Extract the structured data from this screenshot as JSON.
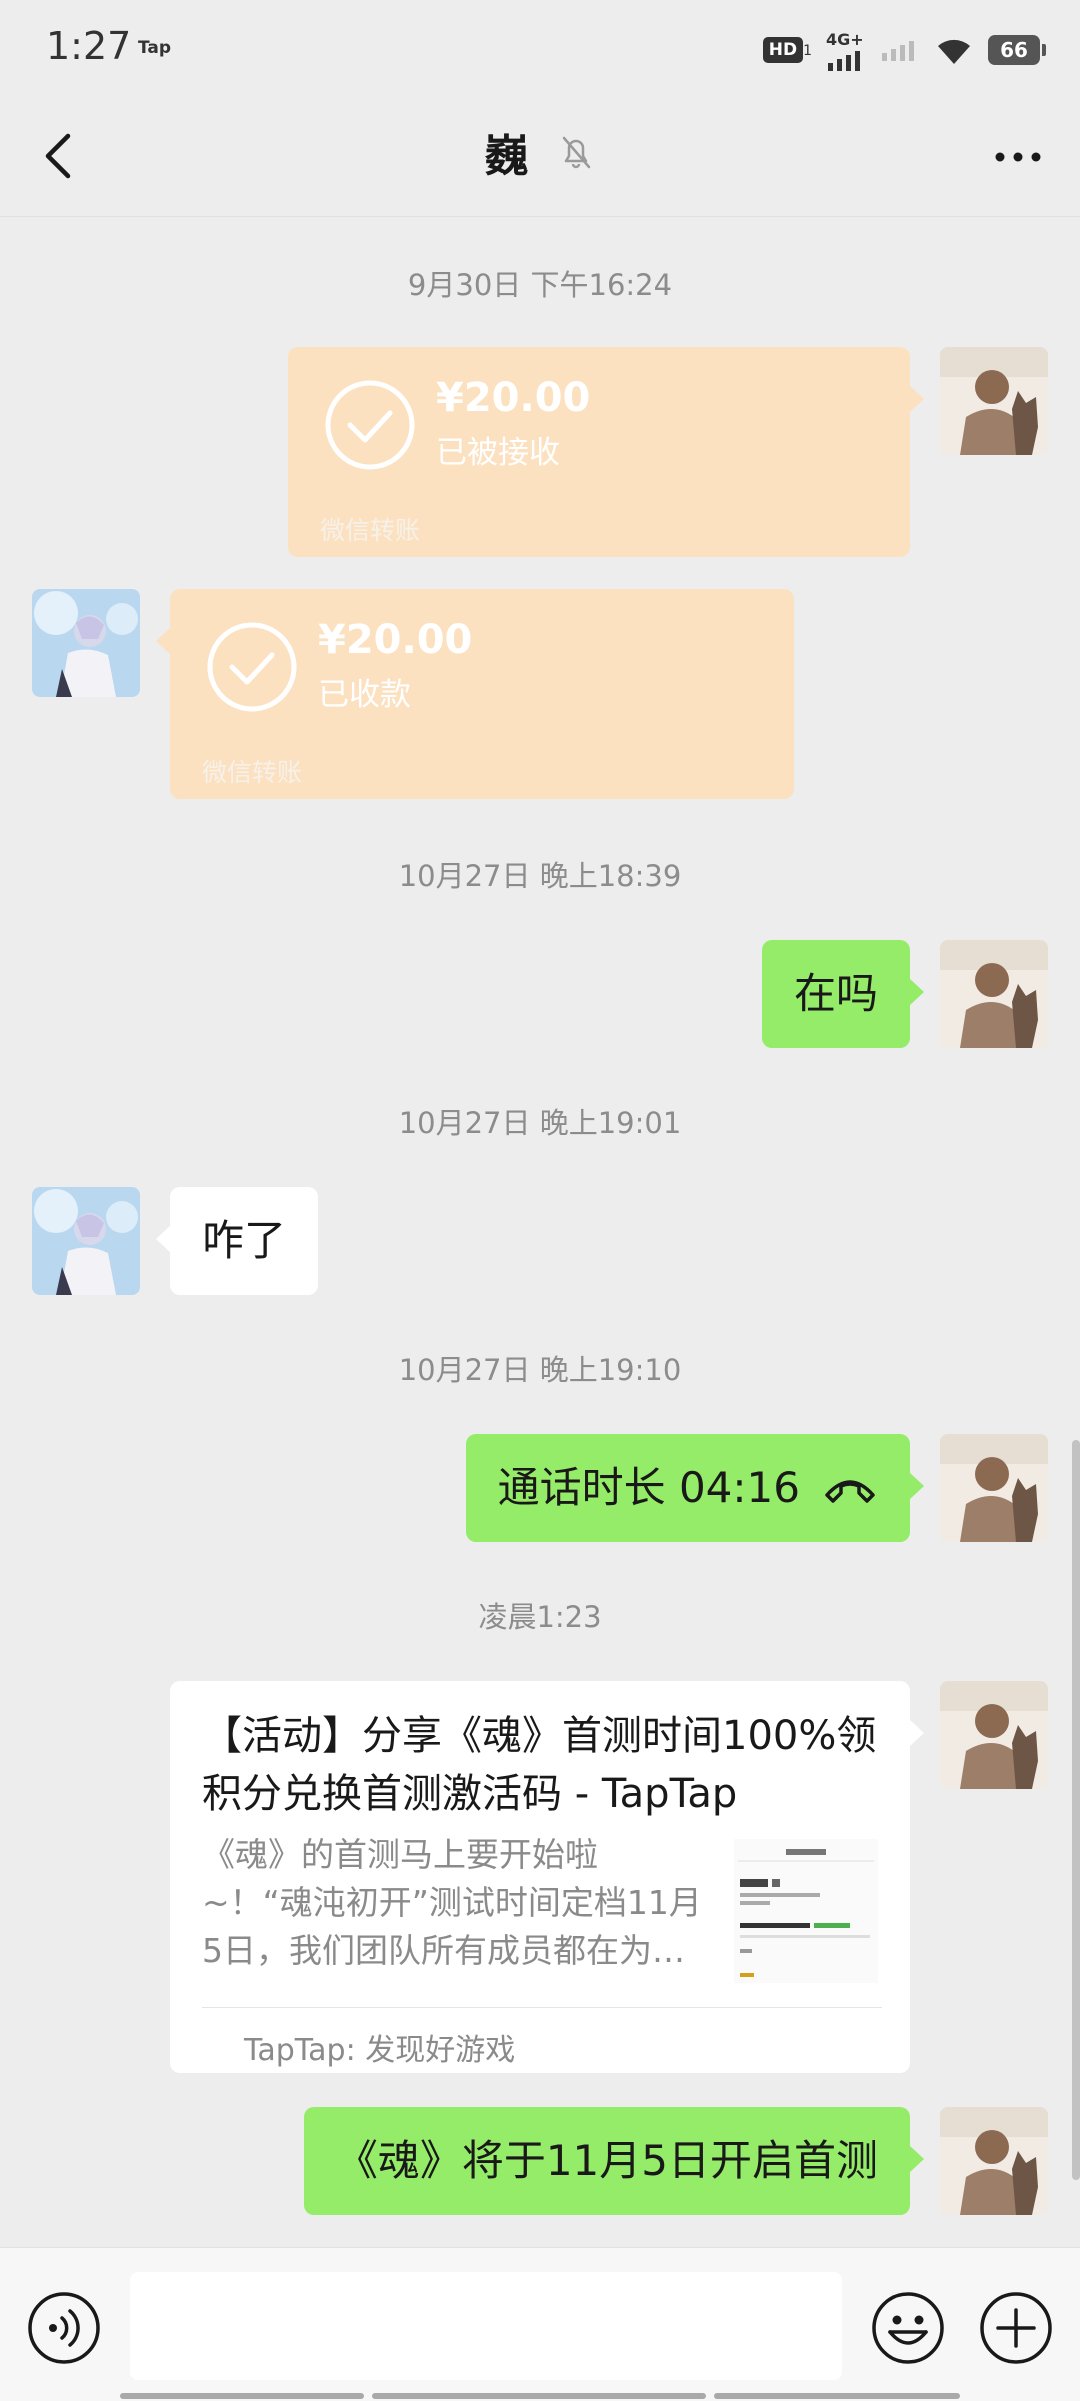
{
  "status_bar": {
    "time": "1:27",
    "app_label": "Tap",
    "hd_badge": "HD",
    "hd_sub": "1",
    "network": "4G+",
    "battery": "66"
  },
  "header": {
    "title": "巍"
  },
  "messages": {
    "ts1": "9月30日 下午16:24",
    "transfer_sent": {
      "amount": "¥20.00",
      "status": "已被接收",
      "footer": "微信转账"
    },
    "transfer_received": {
      "amount": "¥20.00",
      "status": "已收款",
      "footer": "微信转账"
    },
    "ts2": "10月27日 晚上18:39",
    "msg_zaima": "在吗",
    "ts3": "10月27日 晚上19:01",
    "msg_zale": "咋了",
    "ts4": "10月27日 晚上19:10",
    "call_text": "通话时长 04:16",
    "ts5": "凌晨1:23",
    "link": {
      "title": "【活动】分享《魂》首测时间100%领积分兑换首测激活码 - TapTap",
      "desc": "《魂》的首测马上要开始啦~！“魂沌初开”测试时间定档11月5日，我们团队所有成员都在为首测做准备",
      "source": "TapTap: 发现好游戏"
    },
    "msg_last": "《魂》将于11月5日开启首测"
  },
  "input_bar": {
    "placeholder": ""
  },
  "colors": {
    "background": "#ededed",
    "bubble_green": "#95ec69",
    "transfer_orange": "#fce1c0"
  }
}
